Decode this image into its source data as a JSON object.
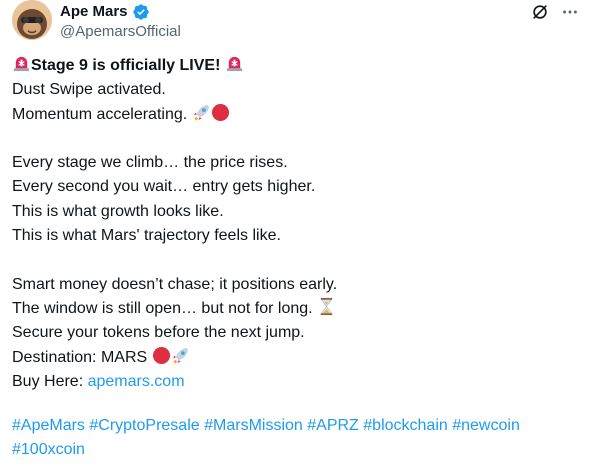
{
  "author": {
    "name": "Ape Mars",
    "handle": "@ApemarsOfficial",
    "verified": true,
    "avatar_icon": "ape-astronaut-avatar"
  },
  "actions": {
    "grok_icon": "grok-icon",
    "more_icon": "more-icon"
  },
  "post": {
    "headline": "Stage 9 is officially LIVE!",
    "lines": [
      "Dust Swipe activated.",
      "Momentum accelerating.",
      "Every stage we climb… the price rises.",
      "Every second you wait… entry gets higher.",
      "This is what growth looks like.",
      "This is what Mars' trajectory feels like.",
      "Smart money doesn’t chase; it positions early.",
      "The window is still open… but not for long.",
      "Secure your tokens before the next jump.",
      "Destination: MARS"
    ],
    "buy_label": "Buy Here:",
    "buy_link": "apemars.com",
    "hashtags": [
      "#ApeMars",
      "#CryptoPresale",
      "#MarsMission",
      "#APRZ",
      "#blockchain",
      "#newcoin",
      "#100xcoin"
    ]
  },
  "colors": {
    "link": "#1d9bf0",
    "text": "#0f1419",
    "secondary": "#536471"
  }
}
